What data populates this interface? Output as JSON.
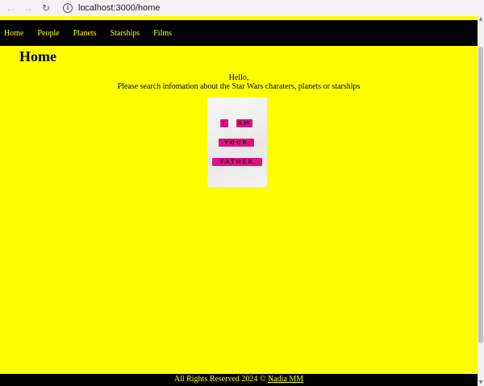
{
  "browser": {
    "back_icon": "arrow-left-icon",
    "forward_icon": "arrow-right-icon",
    "reload_icon": "reload-icon",
    "info_icon": "info-icon",
    "url": "localhost:3000/home"
  },
  "nav": {
    "items": [
      {
        "label": "Home"
      },
      {
        "label": "People"
      },
      {
        "label": "Planets"
      },
      {
        "label": "Starships"
      },
      {
        "label": "Films"
      }
    ]
  },
  "main": {
    "title": "Home",
    "greeting": "Hello,",
    "intro": "Please search infomation about the Star Wars charaters, planets or starships",
    "image": {
      "tiles": [
        [
          "I",
          "AM"
        ],
        [
          "YOUR"
        ],
        [
          "FATHER"
        ]
      ]
    }
  },
  "footer": {
    "text": "All Rights Reserved 2024 ©",
    "author_link": "Nadia MM"
  },
  "colors": {
    "page_background": "#ffff00",
    "nav_background": "#000000",
    "nav_text": "#ffff00",
    "tile": "#d9157f"
  }
}
